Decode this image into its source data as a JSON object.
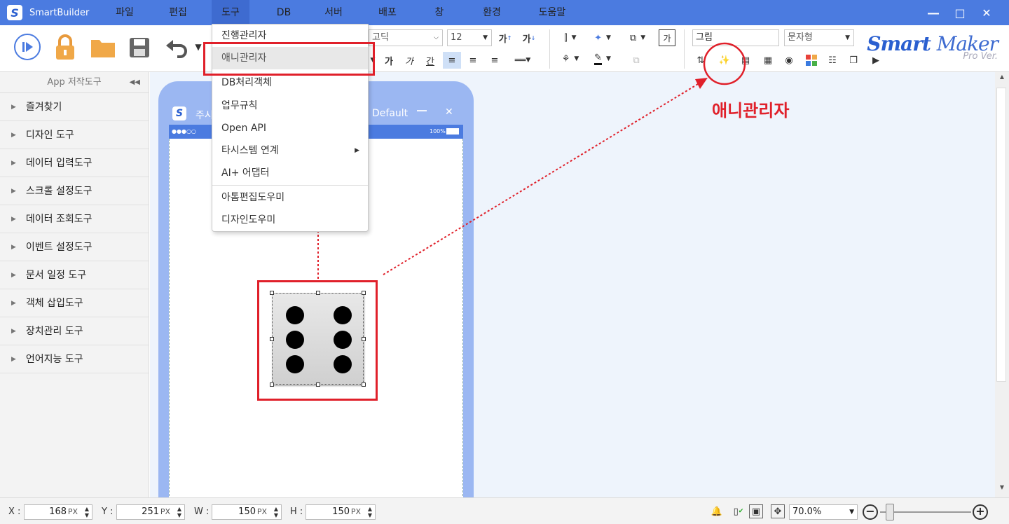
{
  "titlebar": {
    "app_name": "SmartBuilder",
    "menus": [
      "파일",
      "편집",
      "도구",
      "DB",
      "서버",
      "배포",
      "창",
      "환경",
      "도움말"
    ],
    "active_menu": "도구"
  },
  "toolbar": {
    "font_name": "고딕",
    "font_size": "12",
    "object_name": "그림",
    "object_type": "문자형",
    "brand_main": "Smart",
    "brand_maker": "Maker",
    "brand_sub": "Pro Ver.",
    "bold_label": "가",
    "italic_label": "가",
    "underline_label": "간"
  },
  "dropdown": {
    "items": [
      {
        "label": "진행관리자"
      },
      {
        "label": "애니관리자"
      },
      {
        "label": "DB처리객체"
      },
      {
        "label": "업무규칙"
      },
      {
        "label": "Open API"
      },
      {
        "label": "타시스템 연계"
      },
      {
        "label": "AI+ 어댑터"
      },
      {
        "label": "아톰편집도우미"
      },
      {
        "label": "디자인도우미"
      }
    ],
    "highlighted": "애니관리자"
  },
  "sidebar": {
    "header": "App 저작도구",
    "items": [
      {
        "label": "즐겨찾기"
      },
      {
        "label": "디자인 도구"
      },
      {
        "label": "데이터 입력도구"
      },
      {
        "label": "스크롤 설정도구"
      },
      {
        "label": "데이터 조회도구"
      },
      {
        "label": "이벤트 설정도구"
      },
      {
        "label": "문서 일정 도구"
      },
      {
        "label": "객체 삽입도구"
      },
      {
        "label": "장치관리 도구"
      },
      {
        "label": "언어지능 도구"
      }
    ]
  },
  "phone": {
    "title_left": "주시",
    "title_right": "Default",
    "status_left": "●●●○○",
    "status_right": "100%"
  },
  "annotation": {
    "label": "애니관리자",
    "color": "#e0202a"
  },
  "statusbar": {
    "x_label": "X :",
    "x_value": "168",
    "y_label": "Y :",
    "y_value": "251",
    "w_label": "W :",
    "w_value": "150",
    "h_label": "H :",
    "h_value": "150",
    "unit": "PX",
    "zoom": "70.0%"
  },
  "colors": {
    "titlebar": "#4b7be0",
    "accent_red": "#e0202a",
    "canvas_bg": "#eef4fc"
  }
}
